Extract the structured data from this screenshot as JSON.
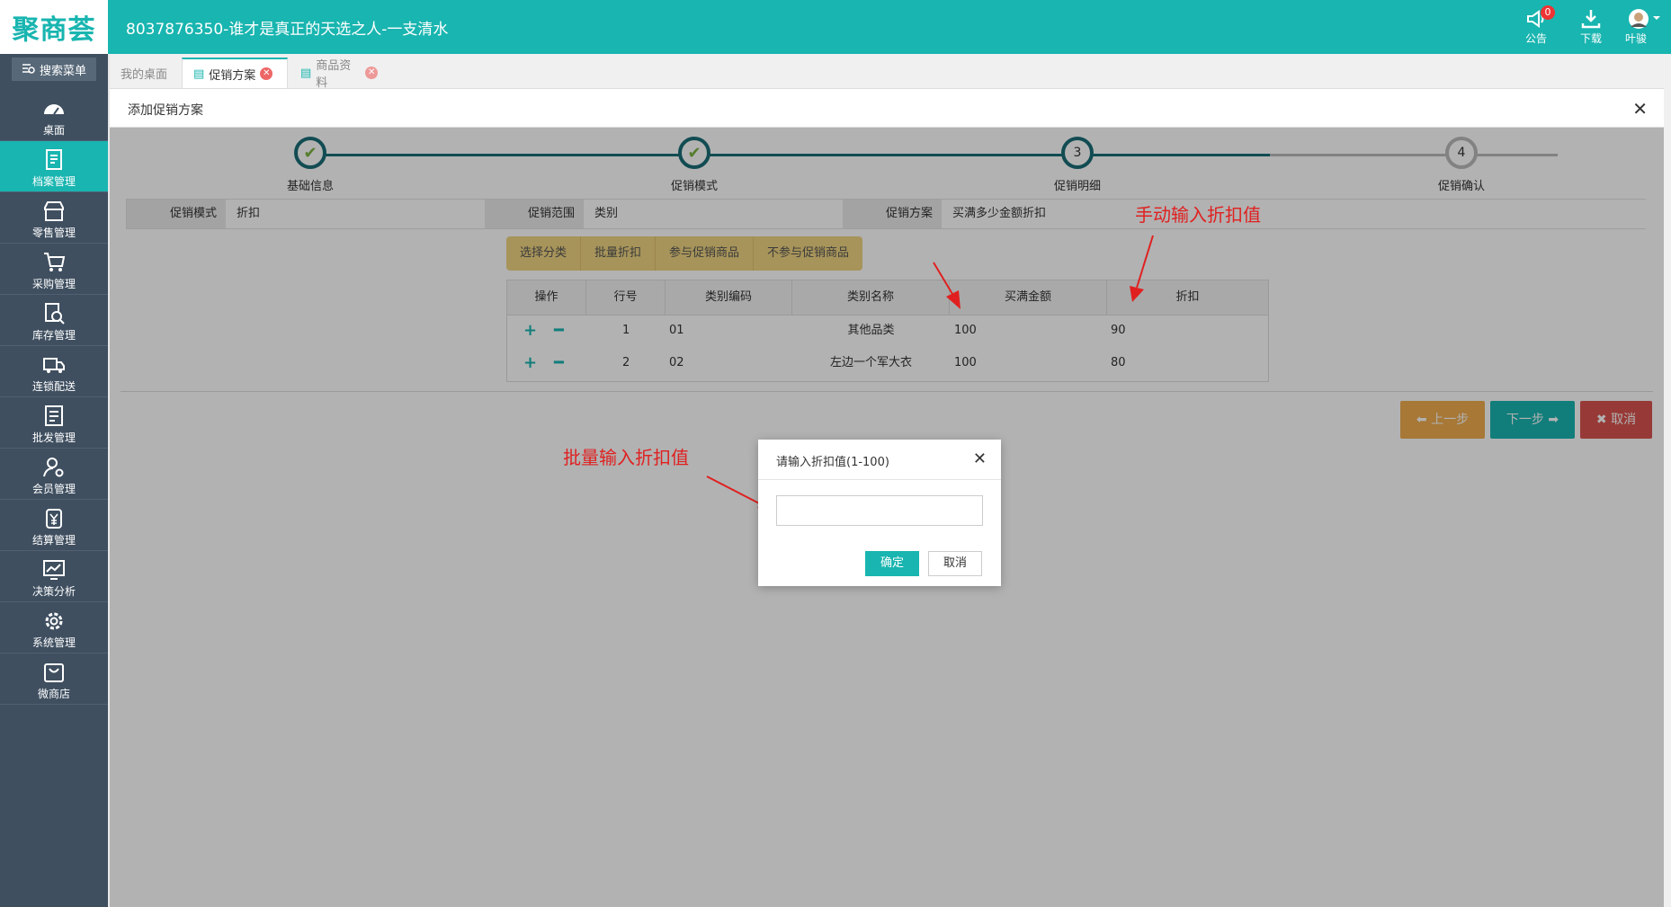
{
  "header": {
    "logo": "聚商荟",
    "title": "8037876350-谁才是真正的天选之人-一支清水",
    "notice_label": "公告",
    "notice_badge": "0",
    "download_label": "下载",
    "user_label": "叶骏"
  },
  "sidebar": {
    "search_label": "搜索菜单",
    "items": [
      {
        "label": "桌面",
        "icon": "dashboard-icon"
      },
      {
        "label": "档案管理",
        "icon": "archive-icon"
      },
      {
        "label": "零售管理",
        "icon": "store-icon"
      },
      {
        "label": "采购管理",
        "icon": "cart-icon"
      },
      {
        "label": "库存管理",
        "icon": "inventory-icon"
      },
      {
        "label": "连锁配送",
        "icon": "truck-icon"
      },
      {
        "label": "批发管理",
        "icon": "wholesale-icon"
      },
      {
        "label": "会员管理",
        "icon": "member-icon"
      },
      {
        "label": "结算管理",
        "icon": "yen-icon"
      },
      {
        "label": "决策分析",
        "icon": "chart-icon"
      },
      {
        "label": "系统管理",
        "icon": "gear-icon"
      },
      {
        "label": "微商店",
        "icon": "bag-icon"
      }
    ]
  },
  "tabs": [
    {
      "label": "我的桌面"
    },
    {
      "label": "促销方案"
    },
    {
      "label": "商品资料"
    }
  ],
  "page": {
    "title": "添加促销方案",
    "steps": [
      {
        "label": "基础信息",
        "number": "1",
        "state": "done"
      },
      {
        "label": "促销模式",
        "number": "2",
        "state": "done"
      },
      {
        "label": "促销明细",
        "number": "3",
        "state": "current"
      },
      {
        "label": "促销确认",
        "number": "4",
        "state": "todo"
      }
    ],
    "info": {
      "mode_label": "促销模式",
      "mode_value": "折扣",
      "scope_label": "促销范围",
      "scope_value": "类别",
      "plan_label": "促销方案",
      "plan_value": "买满多少金额折扣"
    },
    "actions": [
      "选择分类",
      "批量折扣",
      "参与促销商品",
      "不参与促销商品"
    ],
    "table": {
      "headers": [
        "操作",
        "行号",
        "类别编码",
        "类别名称",
        "买满金额",
        "折扣"
      ],
      "rows": [
        {
          "row": "1",
          "code": "01",
          "name": "其他品类",
          "amount": "100",
          "discount": "90"
        },
        {
          "row": "2",
          "code": "02",
          "name": "左边一个军大衣",
          "amount": "100",
          "discount": "80"
        }
      ]
    },
    "prev_label": "上一步",
    "next_label": "下一步",
    "cancel_label": "取消"
  },
  "dialog": {
    "title": "请输入折扣值(1-100)",
    "input_value": "",
    "ok_label": "确定",
    "cancel_label": "取消"
  },
  "annotations": {
    "manual": "手动输入折扣值",
    "batch": "批量输入折扣值"
  },
  "colors": {
    "brand": "#19b5b0",
    "sidebar": "#3f4f60",
    "step_done": "#1a6e77",
    "action_group": "#f0d482",
    "prev_btn": "#f0ad4e",
    "next_btn": "#19b5b0",
    "cancel_btn": "#d9534f",
    "annotation": "#e02020"
  }
}
